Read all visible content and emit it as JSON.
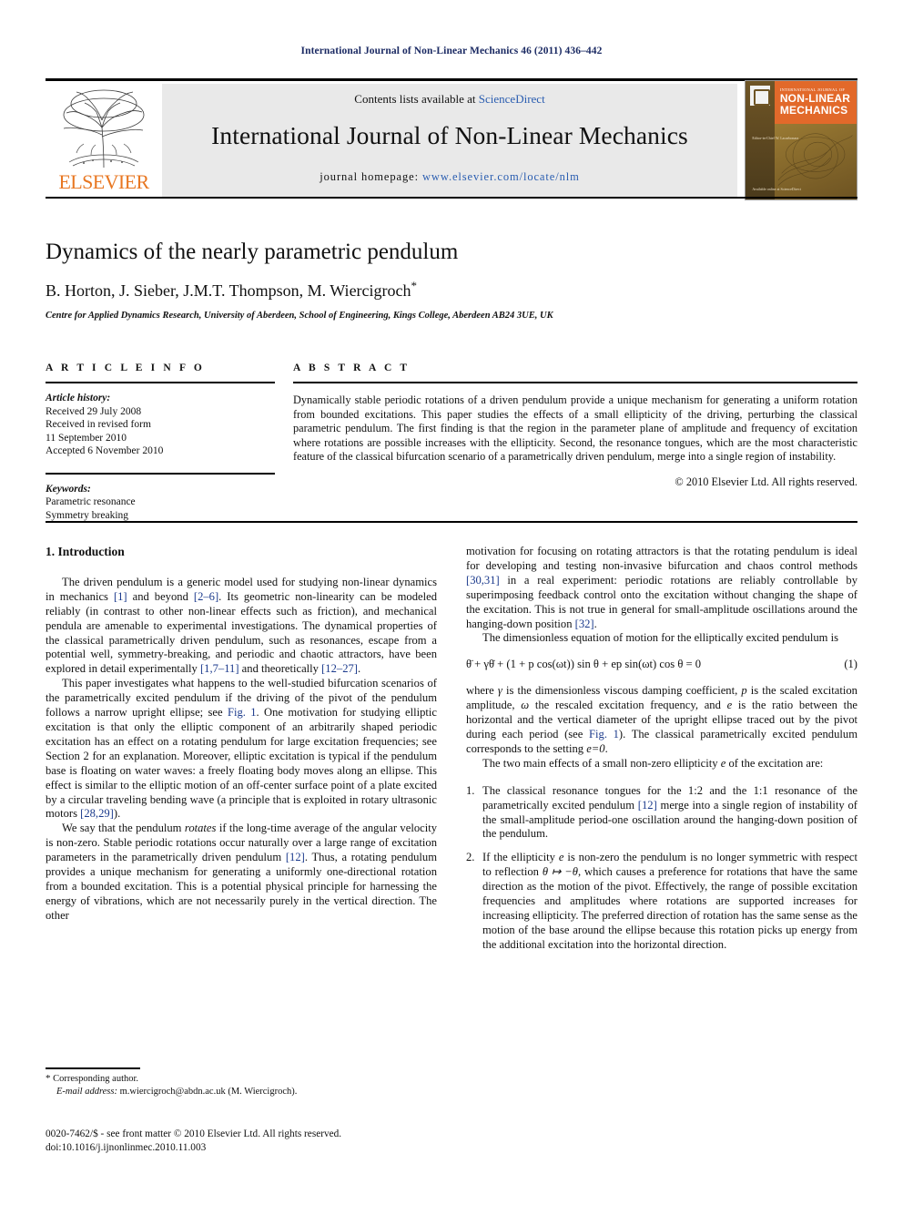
{
  "running_head": "International Journal of Non-Linear Mechanics 46 (2011) 436–442",
  "masthead": {
    "contents_prefix": "Contents lists available at",
    "sciencedirect": "ScienceDirect",
    "journal_title": "International Journal of Non-Linear Mechanics",
    "homepage_label": "journal homepage:",
    "homepage_url": "www.elsevier.com/locate/nlm",
    "publisher_logo": "ELSEVIER",
    "cover": {
      "kicker": "INTERNATIONAL JOURNAL OF",
      "line1": "NON-LINEAR",
      "line2": "MECHANICS",
      "small_left": "Editor-in-Chief\nW. Lacarbonara",
      "footer": "Available online at\nScienceDirect"
    }
  },
  "article": {
    "title": "Dynamics of the nearly parametric pendulum",
    "authors": "B. Horton, J. Sieber, J.M.T. Thompson, M. Wiercigroch",
    "corresponding_marker": "*",
    "affiliation": "Centre for Applied Dynamics Research, University of Aberdeen, School of Engineering, Kings College, Aberdeen AB24 3UE, UK"
  },
  "article_info": {
    "heading": "A R T I C L E    I N F O",
    "history_label": "Article history:",
    "history": [
      "Received 29 July 2008",
      "Received in revised form",
      "11 September 2010",
      "Accepted 6 November 2010"
    ],
    "keywords_label": "Keywords:",
    "keywords": [
      "Parametric resonance",
      "Symmetry breaking"
    ]
  },
  "abstract": {
    "heading": "A B S T R A C T",
    "text": "Dynamically stable periodic rotations of a driven pendulum provide a unique mechanism for generating a uniform rotation from bounded excitations. This paper studies the effects of a small ellipticity of the driving, perturbing the classical parametric pendulum. The first finding is that the region in the parameter plane of amplitude and frequency of excitation where rotations are possible increases with the ellipticity. Second, the resonance tongues, which are the most characteristic feature of the classical bifurcation scenario of a parametrically driven pendulum, merge into a single region of instability.",
    "copyright": "© 2010 Elsevier Ltd. All rights reserved."
  },
  "body": {
    "section_heading": "1. Introduction",
    "left_paragraphs": [
      {
        "parts": [
          {
            "t": "The driven pendulum is a generic model used for studying non-linear dynamics in mechanics "
          },
          {
            "t": "[1]",
            "ref": true
          },
          {
            "t": " and beyond "
          },
          {
            "t": "[2–6]",
            "ref": true
          },
          {
            "t": ". Its geometric non-linearity can be modeled reliably (in contrast to other non-linear effects such as friction), and mechanical pendula are amenable to experimental investigations. The dynamical properties of the classical parametrically driven pendulum, such as resonances, escape from a potential well, symmetry-breaking, and periodic and chaotic attractors, have been explored in detail experimentally "
          },
          {
            "t": "[1,7–11]",
            "ref": true
          },
          {
            "t": " and theoretically "
          },
          {
            "t": "[12–27]",
            "ref": true
          },
          {
            "t": "."
          }
        ]
      },
      {
        "parts": [
          {
            "t": "This paper investigates what happens to the well-studied bifurcation scenarios of the parametrically excited pendulum if the driving of the pivot of the pendulum follows a narrow upright ellipse; see "
          },
          {
            "t": "Fig. 1",
            "ref": true
          },
          {
            "t": ". One motivation for studying elliptic excitation is that only the elliptic component of an arbitrarily shaped periodic excitation has an effect on a rotating pendulum for large excitation frequencies; see Section 2 for an explanation. Moreover, elliptic excitation is typical if the pendulum base is floating on water waves: a freely floating body moves along an ellipse. This effect is similar to the elliptic motion of an off-center surface point of a plate excited by a circular traveling bending wave (a principle that is exploited in rotary ultrasonic motors "
          },
          {
            "t": "[28,29]",
            "ref": true
          },
          {
            "t": ")."
          }
        ]
      },
      {
        "parts": [
          {
            "t": "We say that the pendulum "
          },
          {
            "t": "rotates",
            "it": true
          },
          {
            "t": " if the long-time average of the angular velocity is non-zero. Stable periodic rotations occur naturally over a large range of excitation parameters in the parametrically driven pendulum "
          },
          {
            "t": "[12]",
            "ref": true
          },
          {
            "t": ". Thus, a rotating pendulum provides a unique mechanism for generating a uniformly one-directional rotation from a bounded excitation. This is a potential physical principle for harnessing the energy of vibrations, which are not necessarily purely in the vertical direction. The other"
          }
        ]
      }
    ],
    "right_paragraphs_top": [
      {
        "noindent": true,
        "parts": [
          {
            "t": "motivation for focusing on rotating attractors is that the rotating pendulum is ideal for developing and testing non-invasive bifurcation and chaos control methods "
          },
          {
            "t": "[30,31]",
            "ref": true
          },
          {
            "t": " in a real experiment: periodic rotations are reliably controllable by superimposing feedback control onto the excitation without changing the shape of the excitation. This is not true in general for small-amplitude oscillations around the hanging-down position "
          },
          {
            "t": "[32]",
            "ref": true
          },
          {
            "t": "."
          }
        ]
      },
      {
        "parts": [
          {
            "t": "The dimensionless equation of motion for the elliptically excited pendulum is"
          }
        ]
      }
    ],
    "equation": {
      "text": "θ̈ + γθ̇ + (1 + p cos(ωt)) sin θ + ep sin(ωt) cos θ = 0",
      "number": "(1)"
    },
    "right_paragraphs_after_eq": [
      {
        "noindent": true,
        "parts": [
          {
            "t": "where "
          },
          {
            "t": "γ",
            "it": true
          },
          {
            "t": " is the dimensionless viscous damping coefficient, "
          },
          {
            "t": "p",
            "it": true
          },
          {
            "t": " is the scaled excitation amplitude, "
          },
          {
            "t": "ω",
            "it": true
          },
          {
            "t": " the rescaled excitation frequency, and "
          },
          {
            "t": "e",
            "it": true
          },
          {
            "t": " is the ratio between the horizontal and the vertical diameter of the upright ellipse traced out by the pivot during each period (see "
          },
          {
            "t": "Fig. 1",
            "ref": true
          },
          {
            "t": "). The classical parametrically excited pendulum corresponds to the setting "
          },
          {
            "t": "e=0",
            "it": true
          },
          {
            "t": "."
          }
        ]
      },
      {
        "parts": [
          {
            "t": "The two main effects of a small non-zero ellipticity "
          },
          {
            "t": "e",
            "it": true
          },
          {
            "t": " of the excitation are:"
          }
        ]
      }
    ],
    "numbered_list": [
      {
        "num": "1.",
        "parts": [
          {
            "t": "The classical resonance tongues for the 1:2 and the 1:1 resonance of the parametrically excited pendulum "
          },
          {
            "t": "[12]",
            "ref": true
          },
          {
            "t": " merge into a single region of instability of the small-amplitude period-one oscillation around the hanging-down position of the pendulum."
          }
        ]
      },
      {
        "num": "2.",
        "parts": [
          {
            "t": "If the ellipticity "
          },
          {
            "t": "e",
            "it": true
          },
          {
            "t": " is non-zero the pendulum is no longer symmetric with respect to reflection "
          },
          {
            "t": "θ ↦ −θ",
            "it": true
          },
          {
            "t": ", which causes a preference for rotations that have the same direction as the motion of the pivot. Effectively, the range of possible excitation frequencies and amplitudes where rotations are supported increases for increasing ellipticity. The preferred direction of rotation has the same sense as the motion of the base around the ellipse because this rotation picks up energy from the additional excitation into the horizontal direction."
          }
        ]
      }
    ]
  },
  "footnote": {
    "corresponding": "Corresponding author.",
    "email_label": "E-mail address:",
    "email": "m.wiercigroch@abdn.ac.uk (M. Wiercigroch)."
  },
  "imprint": {
    "line1": "0020-7462/$ - see front matter © 2010 Elsevier Ltd. All rights reserved.",
    "line2": "doi:10.1016/j.ijnonlinmec.2010.11.003"
  }
}
